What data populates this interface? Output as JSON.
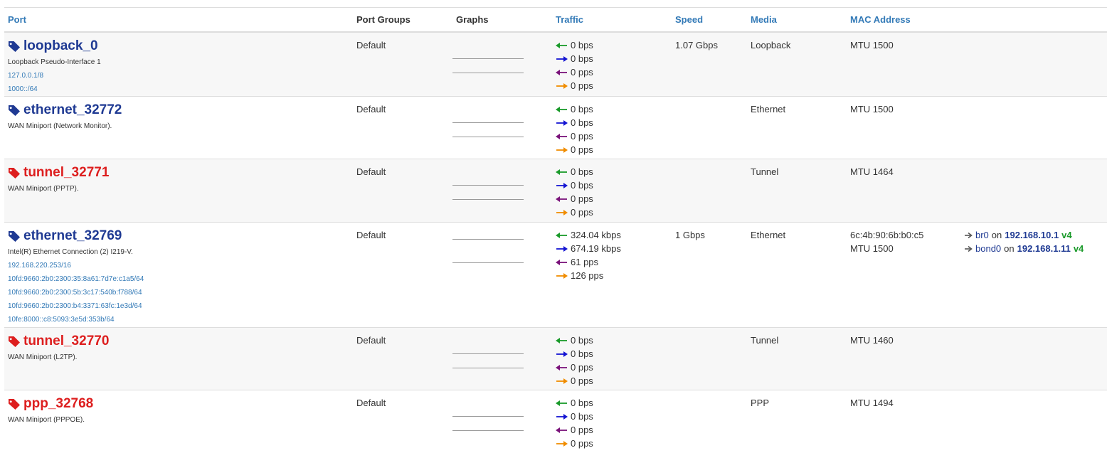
{
  "headers": {
    "port": "Port",
    "port_groups": "Port Groups",
    "graphs": "Graphs",
    "traffic": "Traffic",
    "speed": "Speed",
    "media": "Media",
    "mac_address": "MAC Address"
  },
  "colors": {
    "link": "#337ab7",
    "port_up": "#1f3a93",
    "port_down": "#dd1e1e",
    "in_bps": "#1a9a2a",
    "out_bps": "#1414d2",
    "in_pps": "#7a127a",
    "out_pps": "#f08c00"
  },
  "ports": [
    {
      "name": "loopback_0",
      "status": "up",
      "tag_icon": "tag-icon",
      "description": "Loopback Pseudo-Interface 1",
      "addresses": [
        "127.0.0.1/8",
        "1000::/64"
      ],
      "group": "Default",
      "traffic": {
        "in_bps": "0 bps",
        "out_bps": "0 bps",
        "in_pps": "0 pps",
        "out_pps": "0 pps"
      },
      "speed": "1.07 Gbps",
      "media": "Loopback",
      "mac": "",
      "mtu": "MTU 1500",
      "neighbors": []
    },
    {
      "name": "ethernet_32772",
      "status": "up",
      "tag_icon": "tag-icon",
      "description": "WAN Miniport (Network Monitor).",
      "addresses": [],
      "group": "Default",
      "traffic": {
        "in_bps": "0 bps",
        "out_bps": "0 bps",
        "in_pps": "0 pps",
        "out_pps": "0 pps"
      },
      "speed": "",
      "media": "Ethernet",
      "mac": "",
      "mtu": "MTU 1500",
      "neighbors": []
    },
    {
      "name": "tunnel_32771",
      "status": "down",
      "tag_icon": "tag-icon",
      "description": "WAN Miniport (PPTP).",
      "addresses": [],
      "group": "Default",
      "traffic": {
        "in_bps": "0 bps",
        "out_bps": "0 bps",
        "in_pps": "0 pps",
        "out_pps": "0 pps"
      },
      "speed": "",
      "media": "Tunnel",
      "mac": "",
      "mtu": "MTU 1464",
      "neighbors": []
    },
    {
      "name": "ethernet_32769",
      "status": "up",
      "tag_icon": "tag-icon",
      "description": "Intel(R) Ethernet Connection (2) I219-V.",
      "addresses": [
        "192.168.220.253/16",
        "10fd:9660:2b0:2300:35:8a61:7d7e:c1a5/64",
        "10fd:9660:2b0:2300:5b:3c17:540b:f788/64",
        "10fd:9660:2b0:2300:b4:3371:63fc:1e3d/64",
        "10fe:8000::c8:5093:3e5d:353b/64"
      ],
      "group": "Default",
      "traffic": {
        "in_bps": "324.04 kbps",
        "out_bps": "674.19 kbps",
        "in_pps": "61 pps",
        "out_pps": "126 pps"
      },
      "speed": "1 Gbps",
      "media": "Ethernet",
      "mac": "6c:4b:90:6b:b0:c5",
      "mtu": "MTU 1500",
      "neighbors": [
        {
          "ifname": "br0",
          "on": "on",
          "ip": "192.168.10.1",
          "ver": "v4"
        },
        {
          "ifname": "bond0",
          "on": "on",
          "ip": "192.168.1.11",
          "ver": "v4"
        }
      ]
    },
    {
      "name": "tunnel_32770",
      "status": "down",
      "tag_icon": "tag-icon",
      "description": "WAN Miniport (L2TP).",
      "addresses": [],
      "group": "Default",
      "traffic": {
        "in_bps": "0 bps",
        "out_bps": "0 bps",
        "in_pps": "0 pps",
        "out_pps": "0 pps"
      },
      "speed": "",
      "media": "Tunnel",
      "mac": "",
      "mtu": "MTU 1460",
      "neighbors": []
    },
    {
      "name": "ppp_32768",
      "status": "down",
      "tag_icon": "tag-icon",
      "description": "WAN Miniport (PPPOE).",
      "addresses": [],
      "group": "Default",
      "traffic": {
        "in_bps": "0 bps",
        "out_bps": "0 bps",
        "in_pps": "0 pps",
        "out_pps": "0 pps"
      },
      "speed": "",
      "media": "PPP",
      "mac": "",
      "mtu": "MTU 1494",
      "neighbors": []
    }
  ]
}
